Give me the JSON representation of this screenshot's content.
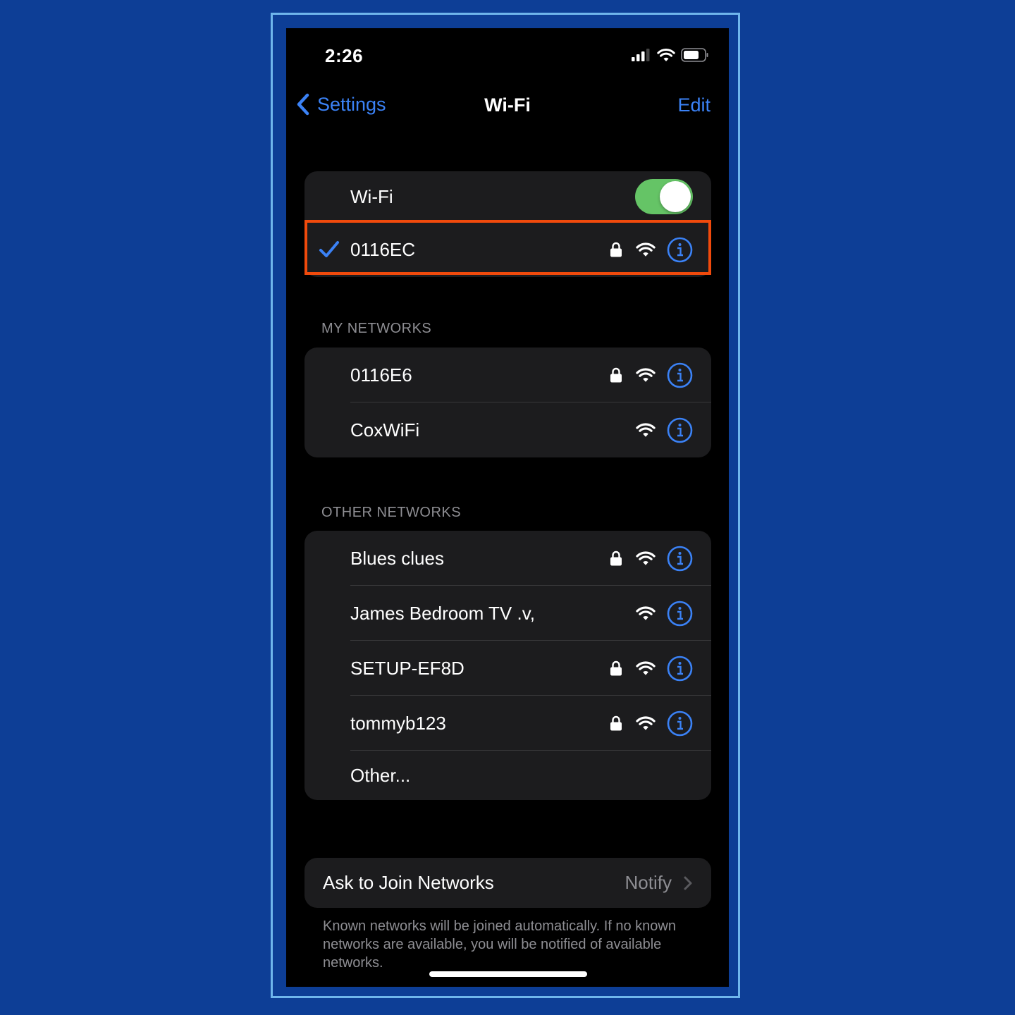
{
  "status_bar": {
    "time": "2:26",
    "icons": [
      "cellular-signal-icon",
      "wifi-icon",
      "battery-icon"
    ]
  },
  "nav": {
    "back_label": "Settings",
    "title": "Wi-Fi",
    "edit_label": "Edit"
  },
  "wifi_toggle": {
    "label": "Wi-Fi",
    "on": true,
    "color": "#65c466"
  },
  "connected_network": {
    "name": "0116EC",
    "secured": true,
    "connected": true,
    "highlight_color": "#f04a0c"
  },
  "my_networks": {
    "header": "MY NETWORKS",
    "items": [
      {
        "name": "0116E6",
        "secured": true
      },
      {
        "name": "CoxWiFi",
        "secured": false
      }
    ]
  },
  "other_networks": {
    "header": "OTHER NETWORKS",
    "items": [
      {
        "name": "Blues clues",
        "secured": true
      },
      {
        "name": "James Bedroom TV .v,",
        "secured": false
      },
      {
        "name": "SETUP-EF8D",
        "secured": true
      },
      {
        "name": "tommyb123",
        "secured": true
      }
    ],
    "other_label": "Other..."
  },
  "ask_to_join": {
    "label": "Ask to Join Networks",
    "value": "Notify",
    "footer": "Known networks will be joined automatically. If no known networks are available, you will be notified of available networks."
  },
  "colors": {
    "accent": "#3b82f6",
    "background": "#0d3e96",
    "frame_border": "#6fb6ec"
  }
}
